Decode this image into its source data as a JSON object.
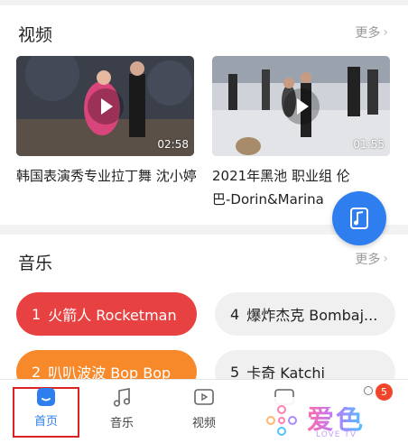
{
  "video_section": {
    "title": "视频",
    "more": "更多",
    "items": [
      {
        "title": "韩国表演秀专业拉丁舞 沈小婷",
        "duration": "02:58"
      },
      {
        "title": "2021年黑池 职业组 伦巴-Dorin&Marina",
        "duration": "01:55"
      }
    ]
  },
  "music_section": {
    "title": "音乐",
    "more": "更多",
    "items": [
      {
        "num": "1",
        "title": "火箭人 Rocketman",
        "color": "#e84141"
      },
      {
        "num": "4",
        "title": "爆炸杰克 Bombaj...",
        "color": "#f0f0f0"
      },
      {
        "num": "2",
        "title": "叭叭波波 Bop Bop",
        "color": "#f7892a"
      },
      {
        "num": "5",
        "title": "卡奇 Katchi",
        "color": "#f0f0f0"
      }
    ]
  },
  "tabbar": {
    "items": [
      {
        "label": "首页",
        "icon": "home-icon",
        "active": true
      },
      {
        "label": "音乐",
        "icon": "music-note-icon"
      },
      {
        "label": "视频",
        "icon": "video-play-icon"
      }
    ],
    "badge": "5"
  },
  "watermark": {
    "text": "爱色",
    "sub": "LOVE TV"
  },
  "colors": {
    "accent": "#2f7ef0",
    "red": "#e84141",
    "orange": "#f7892a"
  }
}
